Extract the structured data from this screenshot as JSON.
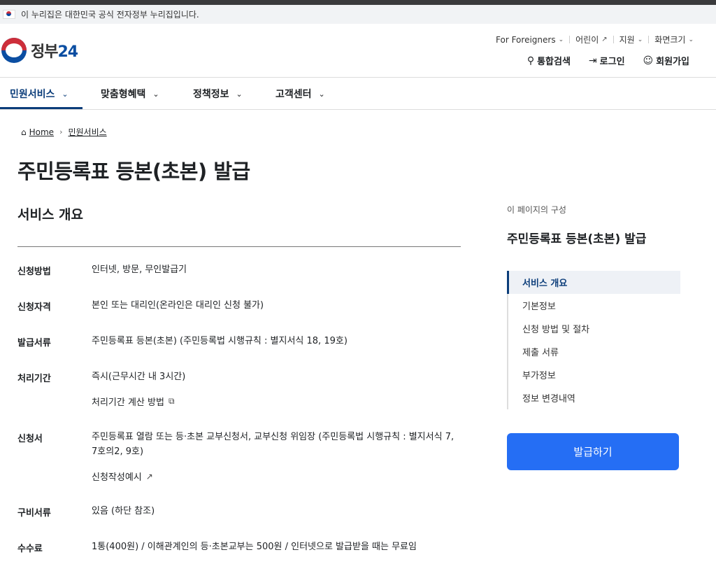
{
  "gov_notice": "이 누리집은 대한민국 공식 전자정부 누리집입니다.",
  "logo": {
    "text": "정부",
    "num": "24"
  },
  "util": {
    "foreigners": "For Foreigners",
    "kids": "어린이",
    "support": "지원",
    "screen_size": "화면크기"
  },
  "actions": {
    "search": "통합검색",
    "login": "로그인",
    "signup": "회원가입"
  },
  "nav": [
    "민원서비스",
    "맞춤형혜택",
    "정책정보",
    "고객센터"
  ],
  "breadcrumb": {
    "home": "Home",
    "current": "민원서비스"
  },
  "page_title": "주민등록표 등본(초본) 발급",
  "section_title": "서비스 개요",
  "rows": [
    {
      "label": "신청방법",
      "value": "인터넷, 방문, 무인발급기"
    },
    {
      "label": "신청자격",
      "value": "본인 또는 대리인(온라인은 대리인 신청 불가)"
    },
    {
      "label": "발급서류",
      "value": "주민등록표 등본(초본) (주민등록법 시행규칙 : 별지서식 18, 19호)"
    },
    {
      "label": "처리기간",
      "value": "즉시(근무시간 내 3시간)",
      "sub": "처리기간 계산 방법"
    },
    {
      "label": "신청서",
      "value": "주민등록표 열람 또는 등·초본 교부신청서, 교부신청 위임장 (주민등록법 시행규칙 : 별지서식 7, 7호의2, 9호)",
      "sub": "신청작성예시"
    },
    {
      "label": "구비서류",
      "value": "있음 (하단 참조)"
    },
    {
      "label": "수수료",
      "value": "1통(400원) / 이해관계인의 등·초본교부는 500원 / 인터넷으로 발급받을 때는 무료임"
    }
  ],
  "sidebar": {
    "caption": "이 페이지의 구성",
    "title": "주민등록표 등본(초본) 발급",
    "toc": [
      "서비스 개요",
      "기본정보",
      "신청 방법 및 절차",
      "제출 서류",
      "부가정보",
      "정보 변경내역"
    ],
    "button": "발급하기"
  }
}
